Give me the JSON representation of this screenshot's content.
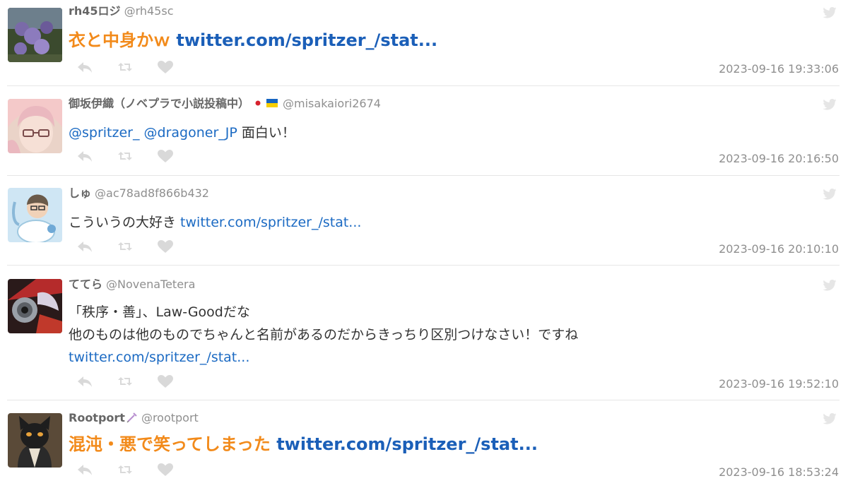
{
  "tweets": [
    {
      "display_name": "rh45ロジ",
      "handle": "@rh45sc",
      "text": "衣と中身かｗ",
      "link": "twitter.com/spritzer_/stat...",
      "timestamp": "2023-09-16 19:33:06",
      "emphasized": true
    },
    {
      "display_name": "御坂伊織（ノベプラで小説投稿中）",
      "handle": "@misakaiori2674",
      "mentions": "@spritzer_ @dragoner_JP",
      "text": " 面白い！",
      "timestamp": "2023-09-16 20:16:50",
      "emphasized": false
    },
    {
      "display_name": "しゅ",
      "handle": "@ac78ad8f866b432",
      "text": "こういうの大好き ",
      "link": "twitter.com/spritzer_/stat...",
      "timestamp": "2023-09-16 20:10:10",
      "emphasized": false
    },
    {
      "display_name": "ててら",
      "handle": "@NovenaTetera",
      "text_line1": "「秩序・善」、Law-Goodだな",
      "text_line2": "他のものは他のものでちゃんと名前があるのだからきっちり区別つけなさい！ですね",
      "link": "twitter.com/spritzer_/stat...",
      "timestamp": "2023-09-16 19:52:10",
      "emphasized": false
    },
    {
      "display_name": "Rootport",
      "handle": "@rootport",
      "text": "混沌・悪で笑ってしまった",
      "link": "twitter.com/spritzer_/stat...",
      "timestamp": "2023-09-16 18:53:24",
      "emphasized": true
    }
  ],
  "icons": {
    "reply": "reply-icon",
    "retweet": "retweet-icon",
    "like": "heart-icon",
    "bird": "twitter-bird-icon"
  },
  "colors": {
    "accent_text": "#f28a1a",
    "link": "#1b6ac3",
    "muted": "#8f8f8f",
    "icon": "#d9d9d9"
  }
}
